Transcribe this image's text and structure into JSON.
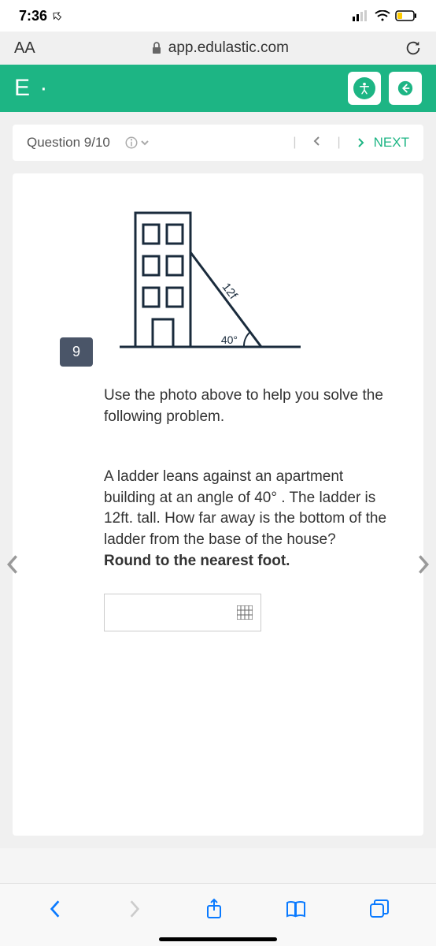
{
  "statusbar": {
    "time": "7:36"
  },
  "address": {
    "aa": "AA",
    "url": "app.edulastic.com"
  },
  "header": {
    "logo": "E ·"
  },
  "nav": {
    "question_label": "Question 9/10",
    "next_label": "NEXT"
  },
  "question": {
    "tag": "9",
    "diagram": {
      "ladder_label": "12f",
      "angle_label": "40°"
    },
    "para1": "Use the photo above to help you solve the following problem.",
    "para2_a": "A ladder leans against an apartment building at an angle of ",
    "para2_angle": "40°",
    "para2_b": " . The ladder is 12ft. tall. How far away is the bottom of the ladder from the base of the house? ",
    "para2_bold": "Round to the nearest foot."
  }
}
